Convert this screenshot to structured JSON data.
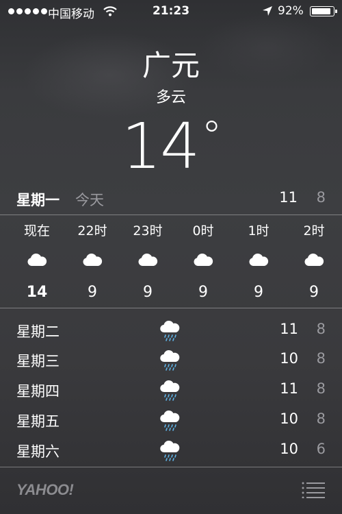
{
  "status_bar": {
    "carrier": "中国移动",
    "time": "21:23",
    "battery_text": "92%",
    "battery_level": 0.92,
    "signal_bars": 5,
    "icons": [
      "signal-dots-icon",
      "wifi-icon",
      "location-arrow-icon",
      "battery-icon"
    ]
  },
  "header": {
    "city": "广元",
    "condition": "多云",
    "temperature": "14",
    "degree_symbol": "°"
  },
  "today": {
    "day": "星期一",
    "label": "今天",
    "high": "11",
    "low": "8"
  },
  "hourly": [
    {
      "time": "现在",
      "temp": "14",
      "icon": "cloud-icon"
    },
    {
      "time": "22时",
      "temp": "9",
      "icon": "cloud-icon"
    },
    {
      "time": "23时",
      "temp": "9",
      "icon": "cloud-icon"
    },
    {
      "time": "0时",
      "temp": "9",
      "icon": "cloud-icon"
    },
    {
      "time": "1时",
      "temp": "9",
      "icon": "cloud-icon"
    },
    {
      "time": "2时",
      "temp": "9",
      "icon": "cloud-icon"
    }
  ],
  "daily": [
    {
      "day": "星期二",
      "high": "11",
      "low": "8",
      "icon": "rain-cloud-icon"
    },
    {
      "day": "星期三",
      "high": "10",
      "low": "8",
      "icon": "rain-cloud-icon"
    },
    {
      "day": "星期四",
      "high": "11",
      "low": "8",
      "icon": "rain-cloud-icon"
    },
    {
      "day": "星期五",
      "high": "10",
      "low": "8",
      "icon": "rain-cloud-icon"
    },
    {
      "day": "星期六",
      "high": "10",
      "low": "6",
      "icon": "rain-cloud-icon"
    }
  ],
  "footer": {
    "brand": "YAHOO!",
    "list_icon": "list-icon"
  },
  "colors": {
    "text": "#ffffff",
    "secondary_text": "#9a9a9f",
    "rain_drops": "#5fb4e8",
    "background": "#3a3b3e"
  }
}
